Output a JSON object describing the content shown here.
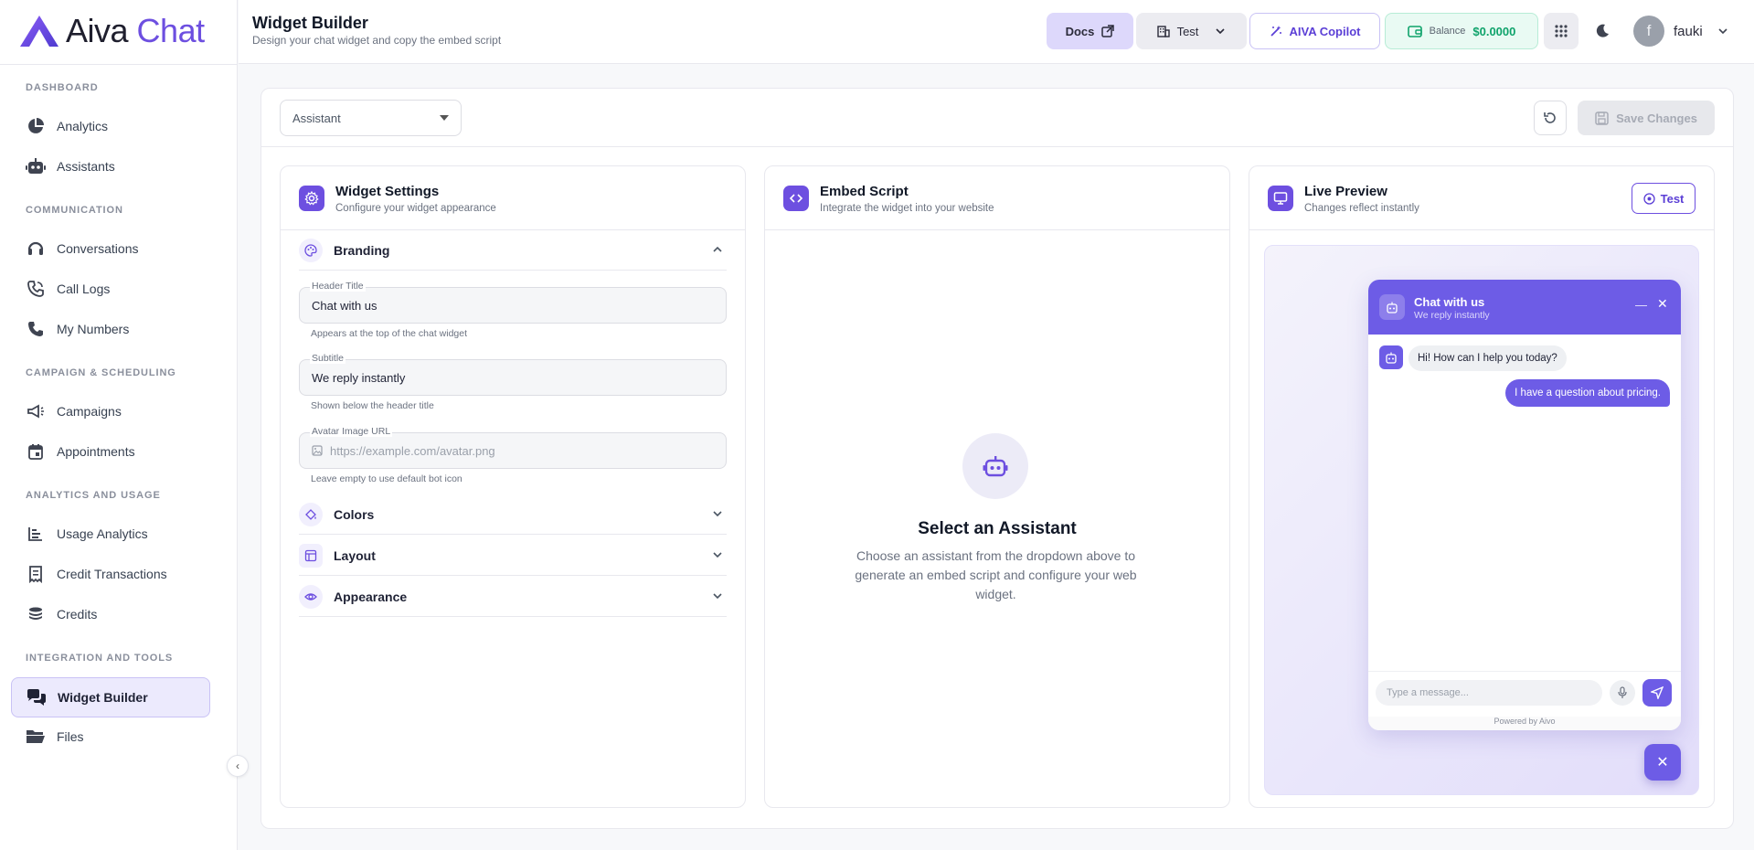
{
  "brand": {
    "name_a": "Aiva",
    "name_b": "Chat"
  },
  "sidebar": {
    "sections": [
      {
        "label": "DASHBOARD"
      },
      {
        "label": "COMMUNICATION"
      },
      {
        "label": "CAMPAIGN & SCHEDULING"
      },
      {
        "label": "ANALYTICS AND USAGE"
      },
      {
        "label": "INTEGRATION AND TOOLS"
      }
    ],
    "items": [
      {
        "label": "Analytics",
        "icon": "pie-chart-icon"
      },
      {
        "label": "Assistants",
        "icon": "robot-icon"
      },
      {
        "label": "Conversations",
        "icon": "headset-icon"
      },
      {
        "label": "Call Logs",
        "icon": "phone-call-icon"
      },
      {
        "label": "My Numbers",
        "icon": "phone-icon"
      },
      {
        "label": "Campaigns",
        "icon": "megaphone-icon"
      },
      {
        "label": "Appointments",
        "icon": "calendar-icon"
      },
      {
        "label": "Usage Analytics",
        "icon": "bar-list-icon"
      },
      {
        "label": "Credit Transactions",
        "icon": "receipt-icon"
      },
      {
        "label": "Credits",
        "icon": "coins-icon"
      },
      {
        "label": "Widget Builder",
        "icon": "chat-bubbles-icon",
        "active": true
      },
      {
        "label": "Files",
        "icon": "folder-icon"
      }
    ]
  },
  "header": {
    "title": "Widget Builder",
    "subtitle": "Design your chat widget and copy the embed script",
    "docs_label": "Docs",
    "workspace_label": "Test",
    "copilot_label": "AIVA Copilot",
    "balance_label": "Balance",
    "balance_value": "$0.0000",
    "user_initial": "f",
    "user_name": "fauki"
  },
  "toolbar": {
    "assistant_select": "Assistant",
    "save_label": "Save Changes"
  },
  "settings": {
    "title": "Widget Settings",
    "subtitle": "Configure your widget appearance",
    "branding_label": "Branding",
    "header_title_label": "Header Title",
    "header_title_value": "Chat with us",
    "header_title_help": "Appears at the top of the chat widget",
    "subtitle_label": "Subtitle",
    "subtitle_value": "We reply instantly",
    "subtitle_help": "Shown below the header title",
    "avatar_label": "Avatar Image URL",
    "avatar_placeholder": "https://example.com/avatar.png",
    "avatar_help": "Leave empty to use default bot icon",
    "colors_label": "Colors",
    "layout_label": "Layout",
    "appearance_label": "Appearance"
  },
  "embed": {
    "title": "Embed Script",
    "subtitle": "Integrate the widget into your website",
    "empty_title": "Select an Assistant",
    "empty_desc": "Choose an assistant from the dropdown above to generate an embed script and configure your web widget."
  },
  "preview": {
    "title": "Live Preview",
    "subtitle": "Changes reflect instantly",
    "test_label": "Test",
    "chat_title": "Chat with us",
    "chat_subtitle": "We reply instantly",
    "bot_message": "Hi! How can I help you today?",
    "user_message": "I have a question about pricing.",
    "input_placeholder": "Type a message...",
    "powered_by": "Powered by Aivo"
  },
  "colors": {
    "accent": "#6d4fe0",
    "widget": "#6d5ce6",
    "balance": "#0fa36b"
  }
}
